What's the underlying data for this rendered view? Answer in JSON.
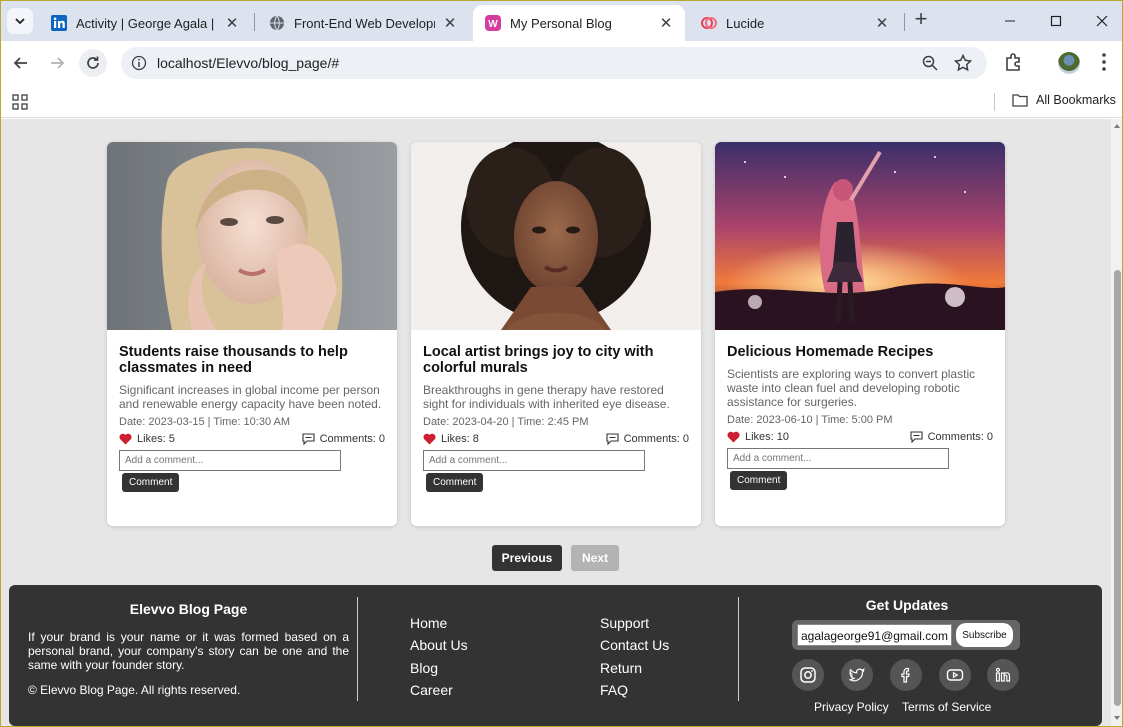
{
  "browser": {
    "tabs": [
      {
        "title": "Activity | George Agala | LinkedIn",
        "favicon": "linkedin-icon",
        "active": false
      },
      {
        "title": "Front-End Web Development",
        "favicon": "globe-icon",
        "active": false
      },
      {
        "title": "My Personal Blog",
        "favicon": "blog-favicon",
        "active": true
      },
      {
        "title": "Lucide",
        "favicon": "lucide-icon",
        "active": false
      }
    ],
    "url": "localhost/Elevvo/blog_page/#",
    "all_bookmarks": "All Bookmarks"
  },
  "posts": [
    {
      "title": "Students raise thousands to help classmates in need",
      "excerpt": "Significant increases in global income per person and renewable energy capacity have been noted.",
      "meta": "Date: 2023-03-15 | Time: 10:30 AM",
      "likes": "Likes: 5",
      "comments": "Comments: 0",
      "comment_placeholder": "Add a comment...",
      "comment_button": "Comment"
    },
    {
      "title": "Local artist brings joy to city with colorful murals",
      "excerpt": "Breakthroughs in gene therapy have restored sight for individuals with inherited eye disease.",
      "meta": "Date: 2023-04-20 | Time: 2:45 PM",
      "likes": "Likes: 8",
      "comments": "Comments: 0",
      "comment_placeholder": "Add a comment...",
      "comment_button": "Comment"
    },
    {
      "title": "Delicious Homemade Recipes",
      "excerpt": "Scientists are exploring ways to convert plastic waste into clean fuel and developing robotic assistance for surgeries.",
      "meta": "Date: 2023-06-10 | Time: 5:00 PM",
      "likes": "Likes: 10",
      "comments": "Comments: 0",
      "comment_placeholder": "Add a comment...",
      "comment_button": "Comment"
    }
  ],
  "pagination": {
    "previous": "Previous",
    "next": "Next",
    "next_disabled": true
  },
  "footer": {
    "brand_title": "Elevvo Blog Page",
    "brand_text": "If your brand is your name or it was formed based on a personal brand, your company's story can be one and the same with your founder story.",
    "copyright": "© Elevvo Blog Page. All rights reserved.",
    "links_col1": [
      "Home",
      "About Us",
      "Blog",
      "Career"
    ],
    "links_col2": [
      "Support",
      "Contact Us",
      "Return",
      "FAQ"
    ],
    "updates_title": "Get Updates",
    "email_value": "agalageorge91@gmail.com",
    "subscribe": "Subscribe",
    "social": [
      "instagram-icon",
      "twitter-icon",
      "facebook-icon",
      "youtube-icon",
      "linkedin-icon"
    ],
    "privacy": "Privacy Policy",
    "terms": "Terms of Service"
  },
  "colors": {
    "accent_dark": "#333333",
    "like_heart": "#cc1f2f",
    "page_bg": "#e6e6e6"
  }
}
